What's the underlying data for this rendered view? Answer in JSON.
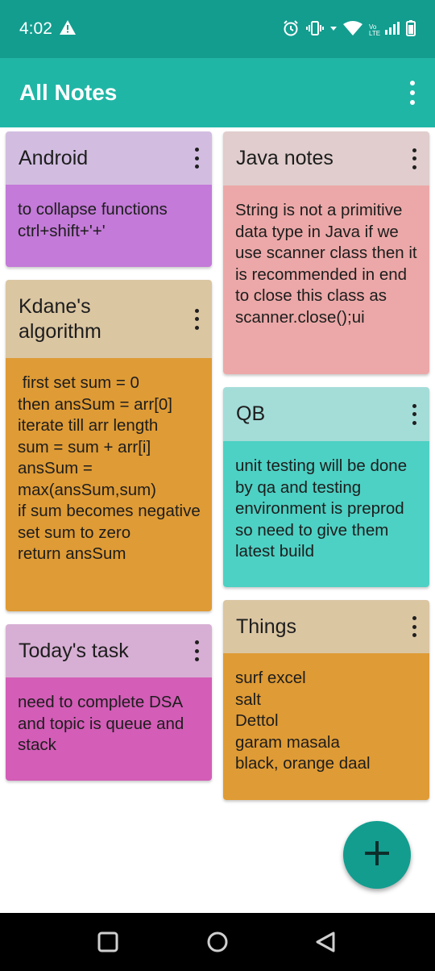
{
  "status_bar": {
    "time": "4:02",
    "icons": [
      "warning-icon",
      "alarm-icon",
      "vibrate-icon",
      "data-arrows-icon",
      "wifi-icon",
      "volte-icon",
      "signal-icon",
      "battery-icon"
    ],
    "volte_label": "Vo LTE"
  },
  "app_bar": {
    "title": "All Notes",
    "menu_icon": "more-vert-icon"
  },
  "colors": {
    "status_bar": "#129d8f",
    "app_bar": "#20b6a6",
    "fab": "#129d8f"
  },
  "notes": [
    {
      "title": "Android",
      "body": "to collapse functions\nctrl+shift+'+'",
      "header_color": "#d2bde1",
      "body_color": "#c37ad8"
    },
    {
      "title": "Kdane's algorithm",
      "body": " first set sum = 0\nthen ansSum = arr[0]\niterate till arr length\nsum = sum + arr[i]\nansSum = max(ansSum,sum)\nif sum becomes negative set sum to zero\nreturn ansSum",
      "header_color": "#dbc6a2",
      "body_color": "#df9b35"
    },
    {
      "title": "Today's task",
      "body": "need to complete DSA and topic is queue and stack",
      "header_color": "#d7afd4",
      "body_color": "#d35db7"
    },
    {
      "title": "Java notes",
      "body": "String is not a primitive data type in Java if we use scanner class then it is recommended in end to close this class as scanner.close();ui",
      "header_color": "#e1cdcd",
      "body_color": "#eca8a8"
    },
    {
      "title": "QB",
      "body": "unit testing will be done by qa and testing environment is preprod so need to give them latest build",
      "header_color": "#a4dcd8",
      "body_color": "#4dd1c4"
    },
    {
      "title": "Things",
      "body": "surf excel\nsalt\nDettol\ngaram masala\nblack, orange daal",
      "header_color": "#dbc6a2",
      "body_color": "#df9b35"
    }
  ],
  "fab": {
    "icon": "add-icon"
  },
  "nav_bar": {
    "icons": [
      "recents-square-icon",
      "home-circle-icon",
      "back-triangle-icon"
    ]
  }
}
